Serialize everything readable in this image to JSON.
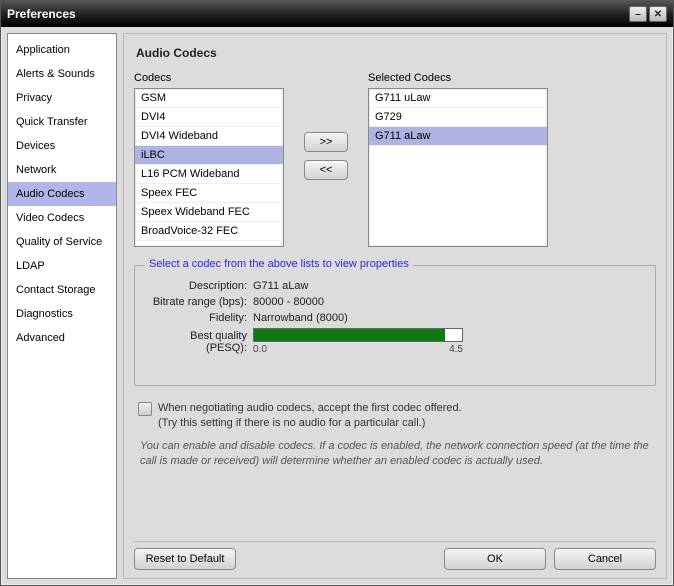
{
  "window": {
    "title": "Preferences",
    "minimize_icon": "–",
    "close_icon": "✕"
  },
  "sidebar": {
    "items": [
      {
        "label": "Application"
      },
      {
        "label": "Alerts & Sounds"
      },
      {
        "label": "Privacy"
      },
      {
        "label": "Quick Transfer"
      },
      {
        "label": "Devices"
      },
      {
        "label": "Network"
      },
      {
        "label": "Audio Codecs",
        "selected": true
      },
      {
        "label": "Video Codecs"
      },
      {
        "label": "Quality of Service"
      },
      {
        "label": "LDAP"
      },
      {
        "label": "Contact Storage"
      },
      {
        "label": "Diagnostics"
      },
      {
        "label": "Advanced"
      }
    ]
  },
  "page": {
    "title": "Audio Codecs",
    "codecs_label": "Codecs",
    "selected_codecs_label": "Selected Codecs",
    "move_right_label": ">>",
    "move_left_label": "<<",
    "available": [
      {
        "label": "GSM"
      },
      {
        "label": "DVI4"
      },
      {
        "label": "DVI4 Wideband"
      },
      {
        "label": "iLBC",
        "selected": true
      },
      {
        "label": "L16 PCM Wideband"
      },
      {
        "label": "Speex FEC"
      },
      {
        "label": "Speex Wideband FEC"
      },
      {
        "label": "BroadVoice-32 FEC"
      }
    ],
    "selected": [
      {
        "label": "G711 uLaw"
      },
      {
        "label": "G729"
      },
      {
        "label": "G711 aLaw",
        "selected": true
      }
    ]
  },
  "properties": {
    "legend": "Select a codec from the above lists to view properties",
    "description_label": "Description:",
    "description_value": "G711 aLaw",
    "bitrate_label": "Bitrate range (bps):",
    "bitrate_value": "80000 - 80000",
    "fidelity_label": "Fidelity:",
    "fidelity_value": "Narrowband (8000)",
    "quality_label": "Best quality (PESQ):",
    "quality_min": "0.0",
    "quality_max": "4.5"
  },
  "options": {
    "accept_first_label": "When negotiating audio codecs, accept the first codec offered.",
    "accept_first_hint": "(Try this setting if there is no audio for a particular call.)"
  },
  "hint": "You can enable and disable codecs. If a codec is enabled, the network connection speed (at the time the call is made or received) will determine whether an enabled codec is actually used.",
  "footer": {
    "reset_label": "Reset to Default",
    "ok_label": "OK",
    "cancel_label": "Cancel"
  }
}
